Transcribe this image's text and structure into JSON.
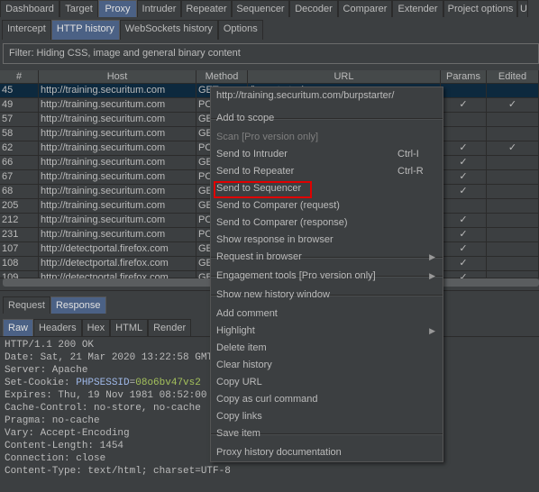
{
  "main_tabs": [
    "Dashboard",
    "Target",
    "Proxy",
    "Intruder",
    "Repeater",
    "Sequencer",
    "Decoder",
    "Comparer",
    "Extender",
    "Project options",
    "U"
  ],
  "main_tab_selected": "Proxy",
  "proxy_tabs": [
    "Intercept",
    "HTTP history",
    "WebSockets history",
    "Options"
  ],
  "proxy_tab_selected": "HTTP history",
  "filter": "Filter: Hiding CSS, image and general binary content",
  "columns": [
    "#",
    "Host",
    "Method",
    "URL",
    "Params",
    "Edited"
  ],
  "rows": [
    {
      "id": "45",
      "host": "http://training.securitum.com",
      "method": "GET",
      "url": "/burpstarter/",
      "params": false,
      "edited": false,
      "selected": true
    },
    {
      "id": "49",
      "host": "http://training.securitum.com",
      "method": "POST",
      "url": "",
      "params": true,
      "edited": true
    },
    {
      "id": "57",
      "host": "http://training.securitum.com",
      "method": "GET",
      "url": "",
      "params": false,
      "edited": false
    },
    {
      "id": "58",
      "host": "http://training.securitum.com",
      "method": "GET",
      "url": "",
      "params": false,
      "edited": false
    },
    {
      "id": "62",
      "host": "http://training.securitum.com",
      "method": "POST",
      "url": "",
      "params": true,
      "edited": true
    },
    {
      "id": "66",
      "host": "http://training.securitum.com",
      "method": "GET",
      "url": "",
      "params": true,
      "edited": false
    },
    {
      "id": "67",
      "host": "http://training.securitum.com",
      "method": "POST",
      "url": "",
      "params": true,
      "edited": false
    },
    {
      "id": "68",
      "host": "http://training.securitum.com",
      "method": "GET",
      "url": "",
      "params": true,
      "edited": false
    },
    {
      "id": "205",
      "host": "http://training.securitum.com",
      "method": "GET",
      "url": "",
      "params": false,
      "edited": false
    },
    {
      "id": "212",
      "host": "http://training.securitum.com",
      "method": "POST",
      "url": "",
      "params": true,
      "edited": false
    },
    {
      "id": "231",
      "host": "http://training.securitum.com",
      "method": "POST",
      "url": "",
      "params": true,
      "edited": false
    },
    {
      "id": "107",
      "host": "http://detectportal.firefox.com",
      "method": "GET",
      "url": "",
      "params": true,
      "edited": false
    },
    {
      "id": "108",
      "host": "http://detectportal.firefox.com",
      "method": "GET",
      "url": "",
      "params": true,
      "edited": false
    }
  ],
  "check_glyph": "✓",
  "msg_tabs": [
    "Request",
    "Response"
  ],
  "msg_tab_selected": "Response",
  "view_tabs": [
    "Raw",
    "Headers",
    "Hex",
    "HTML",
    "Render"
  ],
  "view_tab_selected": "Raw",
  "response_lines": [
    {
      "text": "HTTP/1.1 200 OK"
    },
    {
      "text": "Date: Sat, 21 Mar 2020 13:22:58 GMT"
    },
    {
      "text": "Server: Apache"
    },
    {
      "text": "Set-Cookie: ",
      "cookie_name": "PHPSESSID",
      "cookie_eq": "=",
      "cookie_value": "08o6bv47vs2"
    },
    {
      "text": "Expires: Thu, 19 Nov 1981 08:52:00 GMT"
    },
    {
      "text": "Cache-Control: no-store, no-cache"
    },
    {
      "text": "Pragma: no-cache"
    },
    {
      "text": "Vary: Accept-Encoding"
    },
    {
      "text": "Content-Length: 1454"
    },
    {
      "text": "Connection: close"
    },
    {
      "text": "Content-Type: text/html; charset=UTF-8"
    }
  ],
  "context_menu": {
    "items": [
      {
        "label": "http://training.securitum.com/burpstarter/"
      },
      {
        "label": "Add to scope"
      },
      {
        "label": "Scan [Pro version only]",
        "disabled": true
      },
      {
        "label": "Send to Intruder",
        "shortcut": "Ctrl-I"
      },
      {
        "label": "Send to Repeater",
        "shortcut": "Ctrl-R"
      },
      {
        "label": "Send to Sequencer",
        "highlighted": true
      },
      {
        "label": "Send to Comparer (request)"
      },
      {
        "label": "Send to Comparer (response)"
      },
      {
        "label": "Show response in browser"
      },
      {
        "label": "Request in browser",
        "submenu": true
      },
      {
        "label": "Engagement tools [Pro version only]",
        "submenu": true
      },
      {
        "label": "Show new history window"
      },
      {
        "label": "Add comment"
      },
      {
        "label": "Highlight",
        "submenu": true
      },
      {
        "label": "Delete item"
      },
      {
        "label": "Clear history"
      },
      {
        "label": "Copy URL"
      },
      {
        "label": "Copy as curl command"
      },
      {
        "label": "Copy links"
      },
      {
        "label": "Save item"
      },
      {
        "label": "Proxy history documentation"
      }
    ],
    "submenu_glyph": "▶",
    "highlight_color": "#e00000"
  },
  "colors": {
    "background": "#3c3f41",
    "selected_tab": "#4b6185",
    "selected_row": "#0d293e",
    "cookie_name": "#9fb8e8",
    "cookie_value": "#a5c25c"
  }
}
